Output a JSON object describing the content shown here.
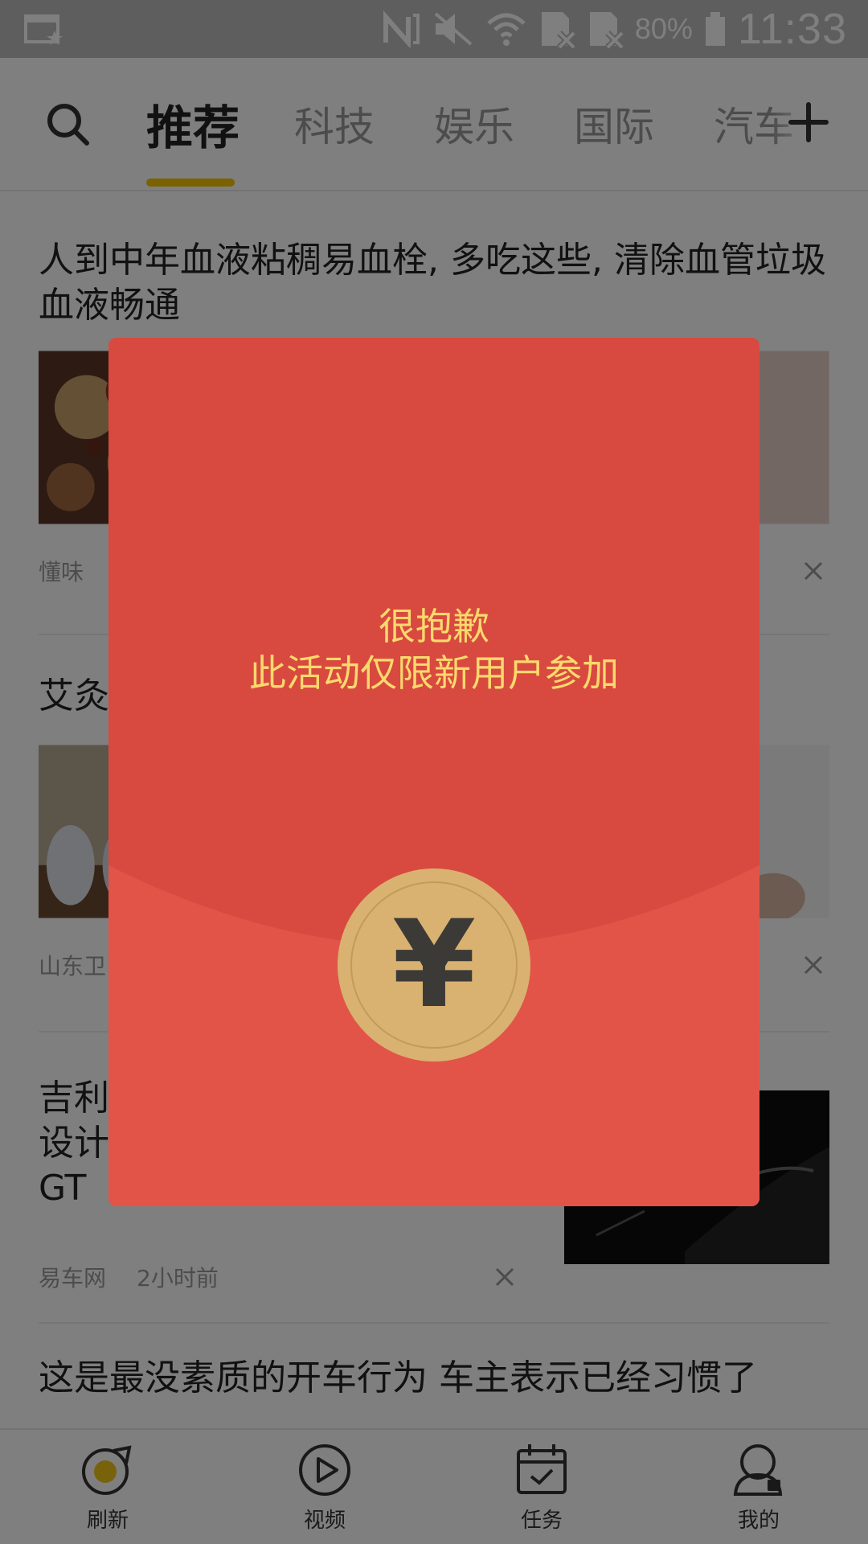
{
  "status_bar": {
    "battery": "80%",
    "time": "11:33"
  },
  "tabs": [
    {
      "label": "推荐",
      "active": true
    },
    {
      "label": "科技"
    },
    {
      "label": "娱乐"
    },
    {
      "label": "国际"
    },
    {
      "label": "汽车"
    }
  ],
  "feed": {
    "articles": [
      {
        "title": "人到中年血液粘稠易血栓, 多吃这些, 清除血管垃圾血液畅通",
        "source": "懂味",
        "time": ""
      },
      {
        "title": "艾灸",
        "source": "山东卫",
        "time": ""
      },
      {
        "title_lines": [
          "吉利",
          "设计",
          "GT"
        ],
        "source": "易车网",
        "time": "2小时前"
      },
      {
        "title": "这是最没素质的开车行为 车主表示已经习惯了"
      }
    ]
  },
  "bottom_nav": [
    {
      "label": "刷新",
      "icon": "refresh-icon"
    },
    {
      "label": "视频",
      "icon": "play-icon"
    },
    {
      "label": "任务",
      "icon": "calendar-check-icon"
    },
    {
      "label": "我的",
      "icon": "user-icon"
    }
  ],
  "modal": {
    "line1": "很抱歉",
    "line2": "此活动仅限新用户参加",
    "coin_symbol": "¥",
    "colors": {
      "envelope_top": "#d84a3f",
      "envelope_bottom": "#e25448",
      "text": "#fbd96d",
      "coin": "#d9b271"
    }
  }
}
